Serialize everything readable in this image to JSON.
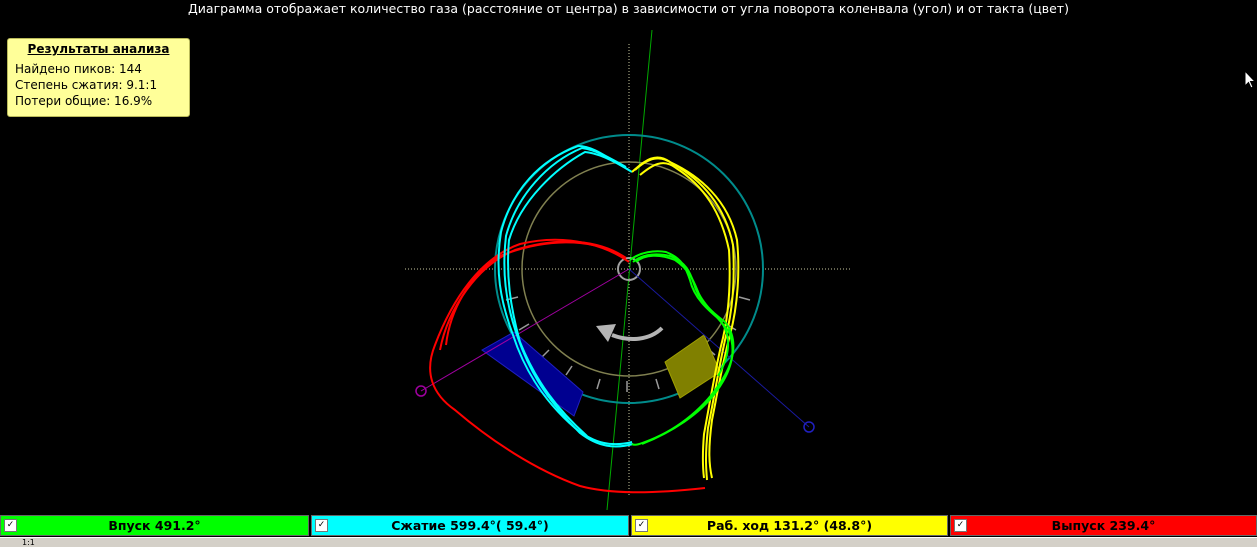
{
  "header": {
    "title": "Диаграмма отображает количество газа (расстояние от центра) в зависимости от угла поворота коленвала (угол) и от такта (цвет)"
  },
  "analysis": {
    "title": "Результаты анализа",
    "peaks": "Найдено пиков: 144",
    "compression": "Степень сжатия: 9.1:1",
    "losses": "Потери общие: 16.9%"
  },
  "legend": [
    {
      "label": "Впуск 491.2°",
      "color": "#00ff00",
      "checked": true
    },
    {
      "label": "Сжатие 599.4°( 59.4°)",
      "color": "#00ffff",
      "checked": true
    },
    {
      "label": "Раб. ход 131.2° (48.8°)",
      "color": "#ffff00",
      "checked": true
    },
    {
      "label": "Выпуск 239.4°",
      "color": "#ff0000",
      "checked": true
    }
  ],
  "status": {
    "scale": "1:1"
  },
  "colors": {
    "intake": "#00ff00",
    "compression": "#00ffff",
    "power": "#ffff00",
    "exhaust": "#ff0000",
    "analysis_bg": "#ffff99"
  },
  "icons": {
    "checkbox": "check-icon",
    "rotation": "rotation-arrow-icon",
    "cursor": "mouse-cursor-icon"
  }
}
